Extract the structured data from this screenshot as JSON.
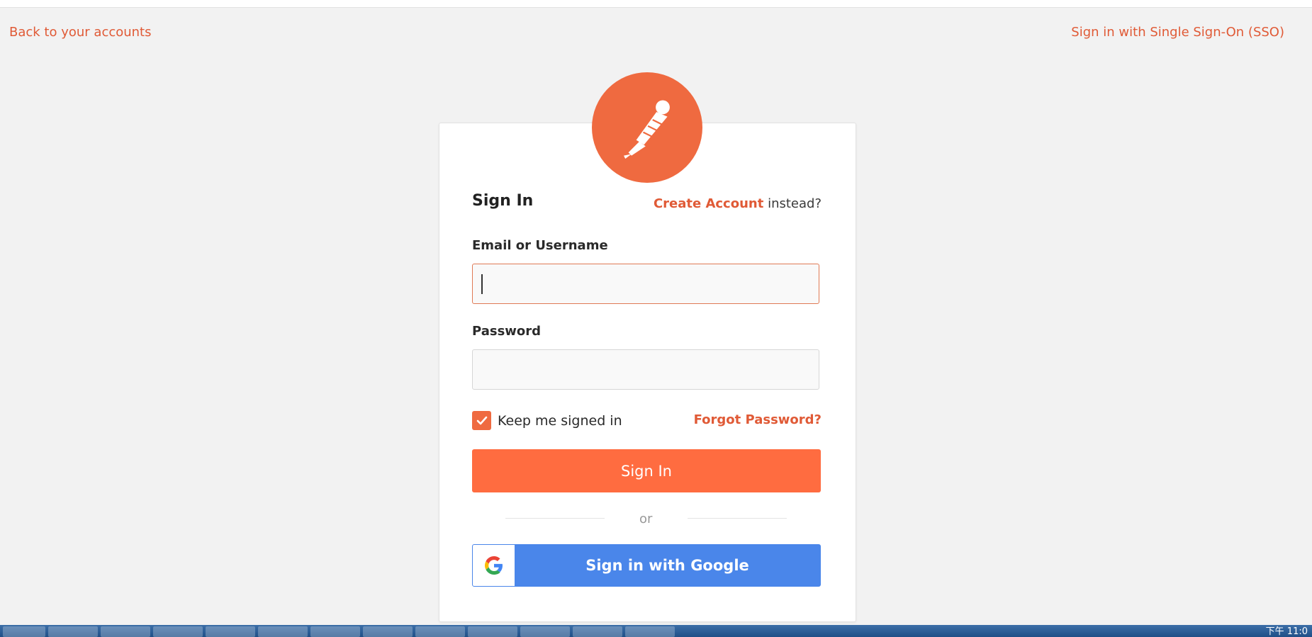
{
  "header": {
    "back_link": "Back to your accounts",
    "sso_link": "Sign in with Single Sign-On (SSO)"
  },
  "card": {
    "logo_icon": "postman-logo-icon",
    "title": "Sign In",
    "create_account_link": "Create Account",
    "create_account_suffix": "instead?",
    "email_label": "Email or Username",
    "email_value": "",
    "password_label": "Password",
    "password_value": "",
    "keep_signed_in_label": "Keep me signed in",
    "keep_signed_in_checked": true,
    "forgot_password_link": "Forgot Password?",
    "sign_in_button": "Sign In",
    "divider_text": "or",
    "google_button": "Sign in with Google"
  },
  "taskbar": {
    "clock": "下午 11:0"
  },
  "colors": {
    "accent": "#ef6a40",
    "button": "#ff6c40",
    "google_blue": "#4a86ea",
    "background": "#f2f2f2"
  }
}
